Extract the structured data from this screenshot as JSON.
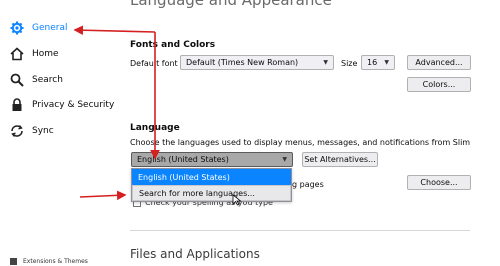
{
  "sidebar": {
    "items": [
      {
        "label": "General",
        "icon": "gear-icon",
        "active": true
      },
      {
        "label": "Home",
        "icon": "home-icon"
      },
      {
        "label": "Search",
        "icon": "search-icon"
      },
      {
        "label": "Privacy & Security",
        "icon": "lock-icon"
      },
      {
        "label": "Sync",
        "icon": "sync-icon"
      }
    ],
    "bottom_label": "Extensions & Themes"
  },
  "main": {
    "cut_heading": "Language and Appearance",
    "fonts": {
      "title": "Fonts and Colors",
      "default_font_label": "Default font",
      "default_font_value": "Default (Times New Roman)",
      "size_label": "Size",
      "size_value": "16",
      "advanced_button": "Advanced...",
      "colors_button": "Colors..."
    },
    "language": {
      "title": "Language",
      "description": "Choose the languages used to display menus, messages, and notifications from SlimBrowser.",
      "selected": "English (United States)",
      "set_alternatives_button": "Set Alternatives...",
      "dropdown_options": [
        "English (United States)",
        "Search for more languages..."
      ],
      "partial_text": "g pages",
      "choose_button": "Choose...",
      "spell_check_label": "Check your spelling as you type"
    },
    "files_heading": "Files and Applications"
  },
  "colors": {
    "accent": "#0a84ff",
    "annotation_arrow": "#d42020"
  }
}
